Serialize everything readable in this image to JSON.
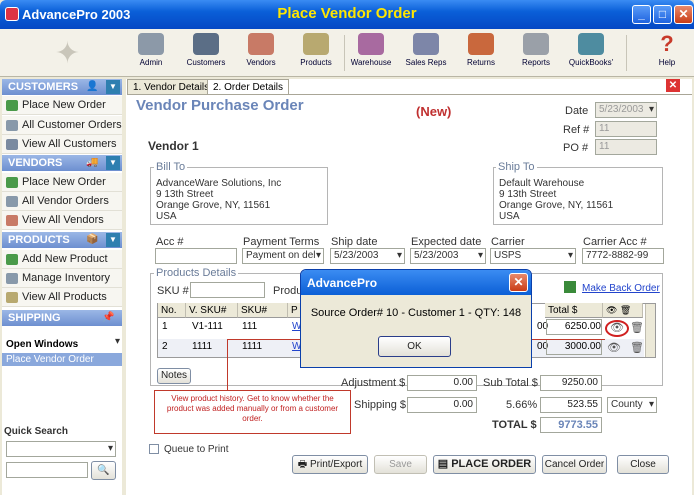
{
  "app": {
    "name": "AdvancePro 2003",
    "window_title": "Place Vendor Order"
  },
  "toolbar": [
    {
      "label": "Admin"
    },
    {
      "label": "Customers"
    },
    {
      "label": "Vendors"
    },
    {
      "label": "Products"
    },
    {
      "label": "Warehouse"
    },
    {
      "label": "Sales Reps"
    },
    {
      "label": "Returns"
    },
    {
      "label": "Reports"
    },
    {
      "label": "QuickBooks'"
    },
    {
      "label": "Help"
    }
  ],
  "sidebar": {
    "customers": {
      "header": "CUSTOMERS",
      "items": [
        "Place New Order",
        "All Customer Orders",
        "View All Customers"
      ]
    },
    "vendors": {
      "header": "VENDORS",
      "items": [
        "Place New Order",
        "All Vendor Orders",
        "View All Vendors"
      ]
    },
    "products": {
      "header": "PRODUCTS",
      "items": [
        "Add New Product",
        "Manage Inventory",
        "View All Products"
      ]
    },
    "shipping": {
      "header": "SHIPPING"
    },
    "open_windows": {
      "header": "Open Windows",
      "selected": "Place Vendor Order"
    },
    "quick_search": {
      "header": "Quick Search"
    }
  },
  "tabs": [
    "1. Vendor Details",
    "2. Order Details"
  ],
  "form": {
    "title": "Vendor Purchase Order",
    "status": "(New)",
    "date_label": "Date",
    "date": "5/23/2003",
    "ref_label": "Ref #",
    "ref": "11",
    "po_label": "PO #",
    "po": "11",
    "vendor": "Vendor 1",
    "bill_to_label": "Bill To",
    "bill_to": "AdvanceWare Solutions, Inc\n9 13th Street\nOrange Grove, NY, 11561\nUSA",
    "ship_to_label": "Ship To",
    "ship_to": "Default Warehouse\n9 13th Street\nOrange Grove, NY, 11561\nUSA",
    "acc_label": "Acc #",
    "payment_terms_label": "Payment Terms",
    "payment_terms": "Payment on del",
    "ship_date_label": "Ship date",
    "ship_date": "5/23/2003",
    "expected_date_label": "Expected date",
    "expected_date": "5/23/2003",
    "carrier_label": "Carrier",
    "carrier": "USPS",
    "carrier_acc_label": "Carrier Acc #",
    "carrier_acc": "7772-8882-99",
    "products_label": "Products Details",
    "sku_label": "SKU #",
    "product_label": "Produ",
    "make_back_order": "Make Back Order"
  },
  "grid": {
    "headers": [
      "No.",
      "V. SKU#",
      "SKU#",
      "P",
      "Total $"
    ],
    "rows": [
      {
        "no": "1",
        "vsku": "V1-111",
        "sku": "111",
        "p": "W",
        "qty_tail": "00",
        "total": "6250.00"
      },
      {
        "no": "2",
        "vsku": "1111",
        "sku": "1111",
        "p": "W",
        "qty_tail": "00",
        "total": "3000.00"
      }
    ]
  },
  "buttons": {
    "notes": "Notes",
    "print": "Print/Export",
    "save": "Save",
    "place": "PLACE ORDER",
    "cancel": "Cancel Order",
    "close": "Close",
    "queue": "Queue to Print"
  },
  "totals": {
    "adjustment_label": "Adjustment $",
    "adjustment": "0.00",
    "shipping_label": "Shipping $",
    "shipping": "0.00",
    "subtotal_label": "Sub Total $",
    "subtotal": "9250.00",
    "tax_rate": "5.66%",
    "tax": "523.55",
    "tax_region": "County",
    "total_label": "TOTAL $",
    "total": "9773.55"
  },
  "dialog": {
    "title": "AdvancePro",
    "message": "Source Order# 10 - Customer 1 - QTY: 148",
    "ok": "OK"
  },
  "annotation": "View product history. Get to know whether the product was added manually or from a customer order."
}
